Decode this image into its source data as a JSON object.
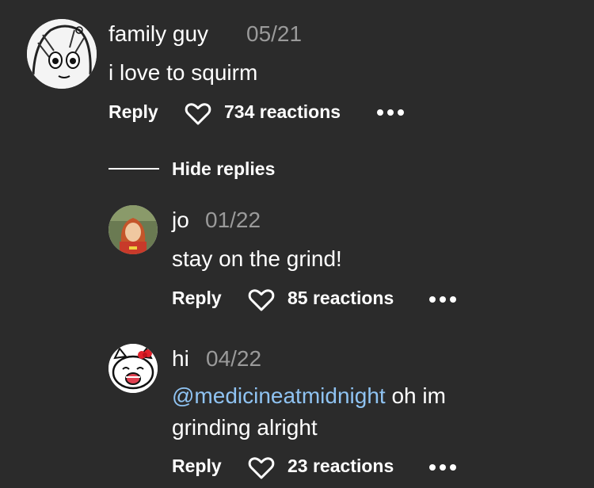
{
  "comments": [
    {
      "author": "family guy",
      "date": "05/21",
      "text": "i love to squirm",
      "reply_label": "Reply",
      "reactions": "734 reactions",
      "avatar_icon": "manga-girl-avatar"
    }
  ],
  "hide_replies_label": "Hide replies",
  "replies": [
    {
      "author": "jo",
      "date": "01/22",
      "text": "stay on the grind!",
      "reply_label": "Reply",
      "reactions": "85 reactions",
      "avatar_icon": "anime-girl-avatar"
    },
    {
      "author": "hi",
      "date": "04/22",
      "mention": "@medicineatmidnight",
      "text_line1": " oh im",
      "text_line2": "grinding alright",
      "reply_label": "Reply",
      "reactions": "23 reactions",
      "avatar_icon": "hello-kitty-avatar"
    }
  ],
  "colors": {
    "background": "#2b2b2b",
    "text": "#ffffff",
    "muted": "#9a9a9a",
    "mention": "#8fc3f2"
  }
}
